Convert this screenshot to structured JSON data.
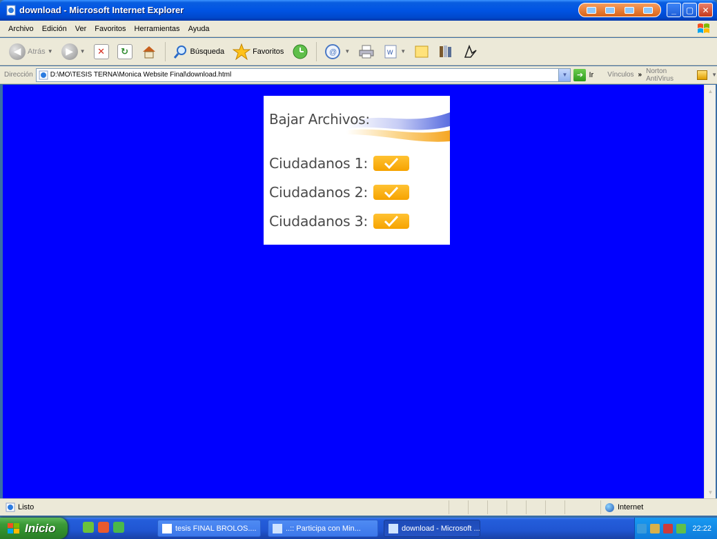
{
  "window": {
    "title": "download - Microsoft Internet Explorer"
  },
  "menu": [
    "Archivo",
    "Edición",
    "Ver",
    "Favoritos",
    "Herramientas",
    "Ayuda"
  ],
  "toolbar": {
    "back_label": "Atrás",
    "search_label": "Búsqueda",
    "favorites_label": "Favoritos"
  },
  "address": {
    "label": "Dirección",
    "value": "D:\\MO\\TESIS TERNA\\Monica Website Final\\download.html",
    "go_label": "Ir",
    "links_label": "Vínculos",
    "more_glyph": "»",
    "norton_label": "Norton AntiVirus"
  },
  "panel": {
    "heading": "Bajar Archivos:",
    "items": [
      {
        "label": "Ciudadanos 1:"
      },
      {
        "label": "Ciudadanos 2:"
      },
      {
        "label": "Ciudadanos 3:"
      }
    ]
  },
  "status": {
    "text": "Listo",
    "zone": "Internet"
  },
  "taskbar": {
    "start_label": "Inicio",
    "tasks": [
      {
        "label": "tesis FINAL BROLOS...."
      },
      {
        "label": "..:: Participa con Min..."
      },
      {
        "label": "download - Microsoft ..."
      }
    ],
    "clock": "22:22"
  },
  "colors": {
    "page_background": "#0000ff",
    "download_button": "#f6a300",
    "titlebar": "#0054e3"
  }
}
